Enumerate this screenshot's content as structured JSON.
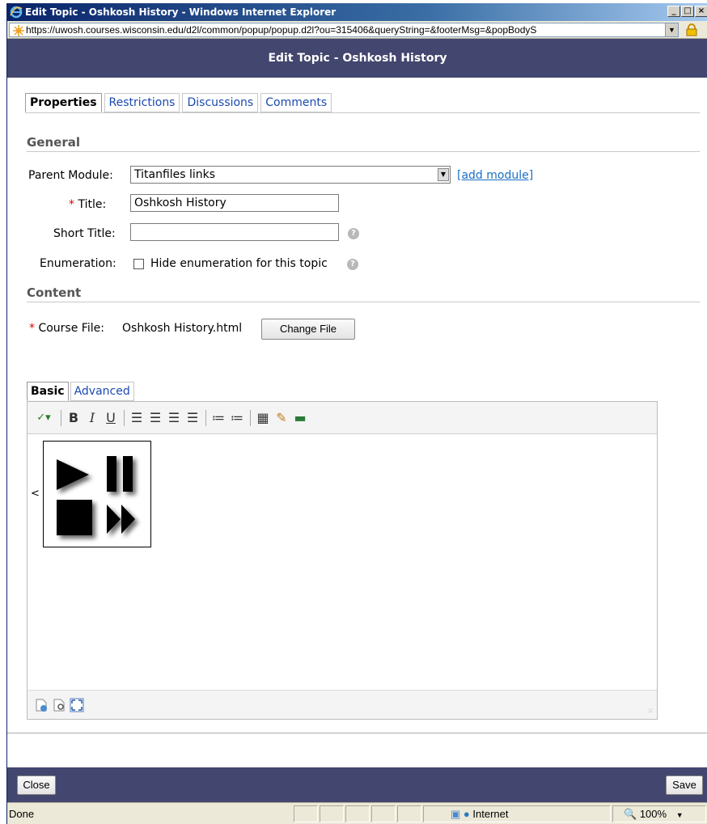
{
  "window": {
    "title": "Edit Topic - Oshkosh History - Windows Internet Explorer",
    "address": "https://uwosh.courses.wisconsin.edu/d2l/common/popup/popup.d2l?ou=315406&queryString=&footerMsg=&popBodyS"
  },
  "dialog": {
    "header": "Edit Topic - Oshkosh History",
    "tabs": [
      "Properties",
      "Restrictions",
      "Discussions",
      "Comments"
    ]
  },
  "general": {
    "section": "General",
    "parent_label": "Parent Module:",
    "parent_value": "Titanfiles links",
    "add_module": "[add module]",
    "title_label": "Title:",
    "title_value": "Oshkosh History",
    "short_title_label": "Short Title:",
    "short_title_value": "",
    "enum_label": "Enumeration:",
    "enum_checkbox": "Hide enumeration for this topic"
  },
  "content": {
    "section": "Content",
    "course_file_label": "Course File:",
    "course_file_value": "Oshkosh History.html",
    "change_file": "Change File",
    "editor_tabs": [
      "Basic",
      "Advanced"
    ],
    "body_char": "<"
  },
  "footer": {
    "close": "Close",
    "save": "Save"
  },
  "status": {
    "text": "Done",
    "zone": "Internet",
    "zoom": "100%"
  },
  "colors": {
    "header_bg": "#43466e",
    "link": "#1a6fc4",
    "required": "#dd0000"
  }
}
